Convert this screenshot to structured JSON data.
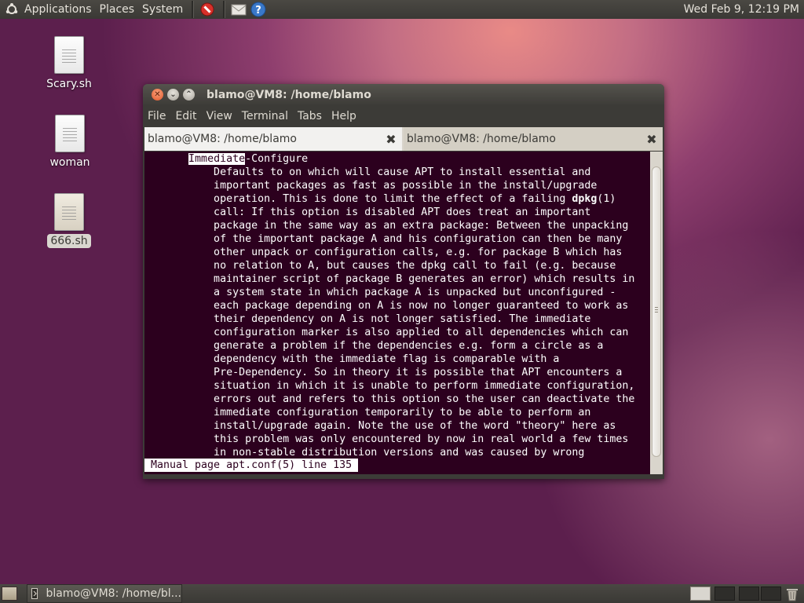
{
  "top_panel": {
    "menus": [
      "Applications",
      "Places",
      "System"
    ],
    "clock": "Wed Feb  9, 12:19 PM",
    "icons": [
      "ubuntu-logo-icon",
      "no-entry-icon",
      "mail-icon",
      "help-icon"
    ]
  },
  "desktop": {
    "icons": [
      {
        "label": "Scary.sh",
        "icon": "script-file-icon",
        "selected": false
      },
      {
        "label": "woman",
        "icon": "text-file-icon",
        "selected": false
      },
      {
        "label": "666.sh",
        "icon": "script-file-icon",
        "selected": true
      }
    ]
  },
  "window": {
    "title": "blamo@VM8: /home/blamo",
    "menu": [
      "File",
      "Edit",
      "View",
      "Terminal",
      "Tabs",
      "Help"
    ],
    "tabs": [
      {
        "label": "blamo@VM8: /home/blamo",
        "active": true
      },
      {
        "label": "blamo@VM8: /home/blamo",
        "active": false
      }
    ],
    "terminal": {
      "heading_highlight": "Immediate",
      "heading_rest": "-Configure",
      "body": "           Defaults to on which will cause APT to install essential and\n           important packages as fast as possible in the install/upgrade\n           operation. This is done to limit the effect of a failing dpkg(1)\n           call: If this option is disabled APT does treat an important\n           package in the same way as an extra package: Between the unpacking\n           of the important package A and his configuration can then be many\n           other unpack or configuration calls, e.g. for package B which has\n           no relation to A, but causes the dpkg call to fail (e.g. because\n           maintainer script of package B generates an error) which results in\n           a system state in which package A is unpacked but unconfigured -\n           each package depending on A is now no longer guaranteed to work as\n           their dependency on A is not longer satisfied. The immediate\n           configuration marker is also applied to all dependencies which can\n           generate a problem if the dependencies e.g. form a circle as a\n           dependency with the immediate flag is comparable with a\n           Pre-Dependency. So in theory it is possible that APT encounters a\n           situation in which it is unable to perform immediate configuration,\n           errors out and refers to this option so the user can deactivate the\n           immediate configuration temporarily to be able to perform an\n           install/upgrade again. Note the use of the word \"theory\" here as\n           this problem was only encountered by now in real world a few times\n           in non-stable distribution versions and was caused by wrong",
      "status_line": "Manual page apt.conf(5) line 135",
      "background": "#2c001e",
      "foreground": "#ffffff"
    }
  },
  "bottom_panel": {
    "task_label": "blamo@VM8: /home/bl...",
    "workspaces": 4,
    "active_workspace": 1
  }
}
